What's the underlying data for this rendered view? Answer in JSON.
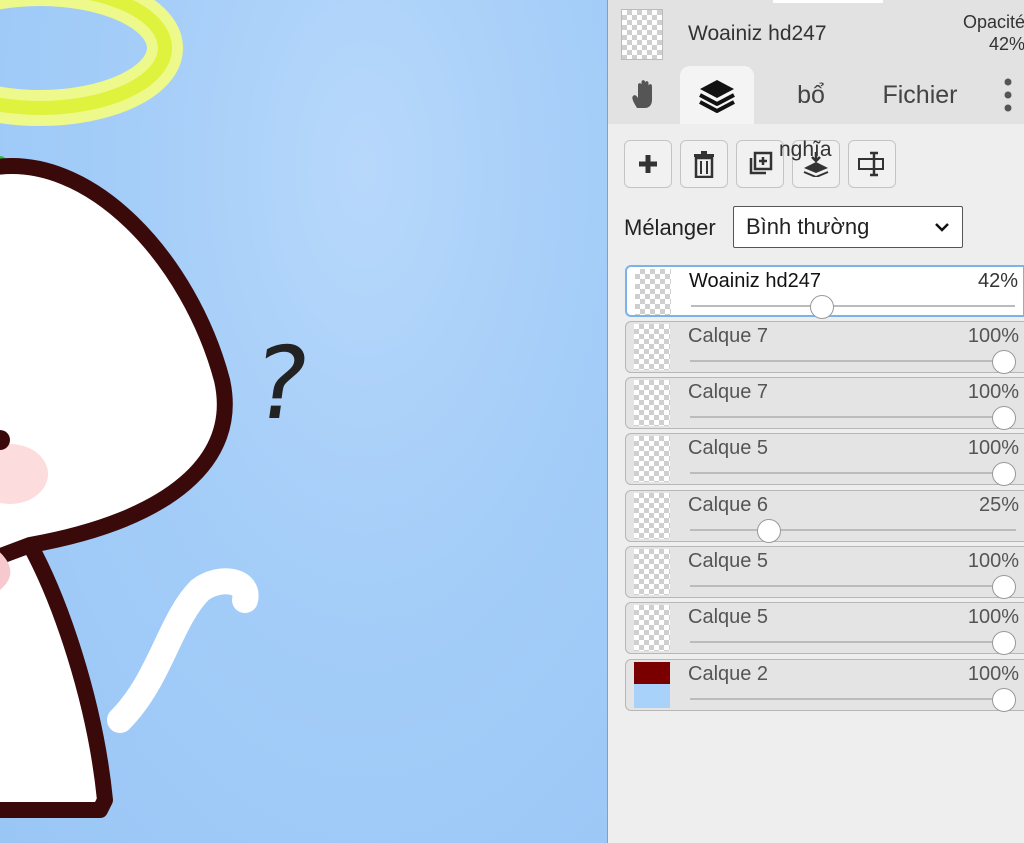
{
  "document": {
    "name": "Woainiz hd247",
    "opacity_label": "Opacité",
    "opacity_value": "42%"
  },
  "tabs": [
    {
      "id": "hand",
      "icon": "hand-icon"
    },
    {
      "id": "layers",
      "icon": "layers-icon",
      "active": true
    },
    {
      "id": "bo",
      "label": "bổ"
    },
    {
      "id": "file",
      "label": "Fichier"
    },
    {
      "id": "more",
      "icon": "more-vertical-icon"
    }
  ],
  "toolbar": {
    "overflow_label": "nghĩa",
    "buttons": [
      "add-layer-button",
      "delete-layer-button",
      "duplicate-layer-button",
      "merge-down-button",
      "rename-layer-button"
    ]
  },
  "blend": {
    "label": "Mélanger",
    "value": "Bình thường"
  },
  "layers": [
    {
      "name": "Woainiz hd247",
      "opacity": "42%",
      "level": 0.42,
      "active": true
    },
    {
      "name": "Calque 7",
      "opacity": "100%",
      "level": 1.0
    },
    {
      "name": "Calque 7",
      "opacity": "100%",
      "level": 1.0
    },
    {
      "name": "Calque 5",
      "opacity": "100%",
      "level": 1.0
    },
    {
      "name": "Calque 6",
      "opacity": "25%",
      "level": 0.25
    },
    {
      "name": "Calque 5",
      "opacity": "100%",
      "level": 1.0
    },
    {
      "name": "Calque 5",
      "opacity": "100%",
      "level": 1.0
    },
    {
      "name": "Calque 2",
      "opacity": "100%",
      "level": 1.0,
      "thumb": "color"
    }
  ],
  "canvas": {
    "annotation": "?"
  },
  "colors": {
    "canvas_bg": "#9cc8f7",
    "outline": "#3a0a0a",
    "halo": "#e3f542",
    "active_border": "#7ab2ea"
  }
}
